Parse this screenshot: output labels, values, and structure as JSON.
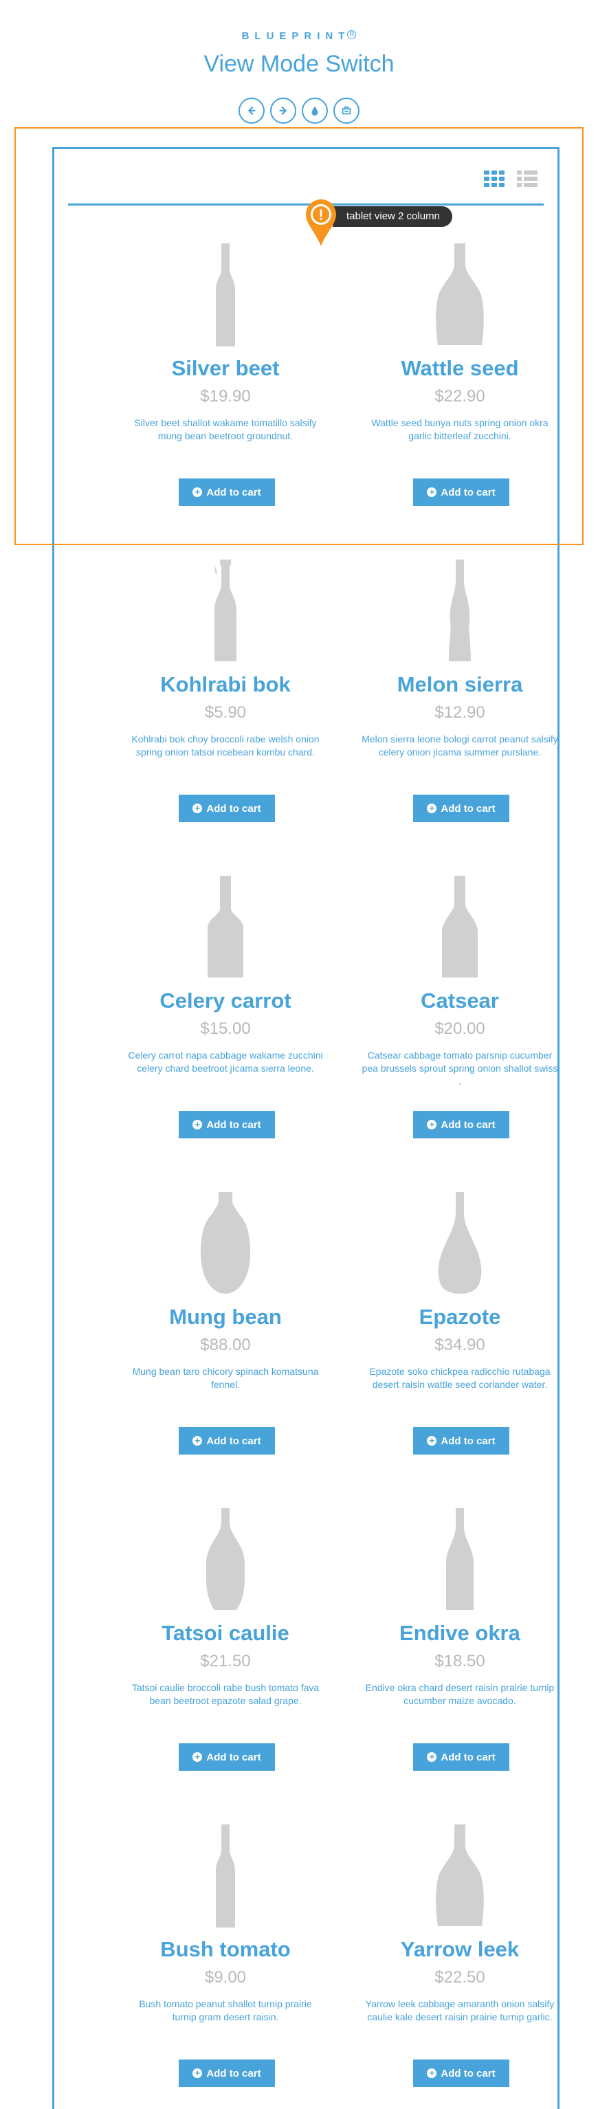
{
  "header": {
    "brand": "BLUEPRINT",
    "brand_mark": "R",
    "title": "View Mode Switch",
    "nav_icons": [
      "arrow-left-icon",
      "arrow-right-icon",
      "drop-icon",
      "archive-icon"
    ]
  },
  "view_toggle": {
    "grid": "grid-view-icon",
    "list": "list-view-icon"
  },
  "tooltip": {
    "icon": "!",
    "text": "tablet view 2 column"
  },
  "colors": {
    "accent": "#47a3da",
    "highlight": "#f7941e",
    "price": "#b9b9b9",
    "bottle": "#d0d0d0",
    "tooltip_bg": "#333333"
  },
  "cart_label": "Add to cart",
  "products": [
    {
      "name": "Silver beet",
      "price": "$19.90",
      "desc": "Silver beet shallot wakame tomatillo salsify mung bean beetroot groundnut.",
      "bottle": "slim"
    },
    {
      "name": "Wattle seed",
      "price": "$22.90",
      "desc": "Wattle seed bunya nuts spring onion okra garlic bitterleaf zucchini.",
      "bottle": "wide"
    },
    {
      "name": "Kohlrabi bok",
      "price": "$5.90",
      "desc": "Kohlrabi bok choy broccoli rabe welsh onion spring onion tatsoi ricebean kombu chard.",
      "bottle": "swing"
    },
    {
      "name": "Melon sierra",
      "price": "$12.90",
      "desc": "Melon sierra leone bologi carrot peanut salsify celery onion jícama summer purslane.",
      "bottle": "soda"
    },
    {
      "name": "Celery carrot",
      "price": "$15.00",
      "desc": "Celery carrot napa cabbage wakame zucchini celery chard beetroot jícama sierra leone.",
      "bottle": "square"
    },
    {
      "name": "Catsear",
      "price": "$20.00",
      "desc": "Catsear cabbage tomato parsnip cucumber pea brussels sprout spring onion shallot swiss .",
      "bottle": "whisky"
    },
    {
      "name": "Mung bean",
      "price": "$88.00",
      "desc": "Mung bean taro chicory spinach komatsuna fennel.",
      "bottle": "round"
    },
    {
      "name": "Epazote",
      "price": "$34.90",
      "desc": "Epazote soko chickpea radicchio rutabaga desert raisin wattle seed coriander water.",
      "bottle": "drop"
    },
    {
      "name": "Tatsoi caulie",
      "price": "$21.50",
      "desc": "Tatsoi caulie broccoli rabe bush tomato fava bean beetroot epazote salad grape.",
      "bottle": "wine"
    },
    {
      "name": "Endive okra",
      "price": "$18.50",
      "desc": "Endive okra chard desert raisin prairie turnip cucumber maize avocado.",
      "bottle": "beer"
    },
    {
      "name": "Bush tomato",
      "price": "$9.00",
      "desc": "Bush tomato peanut shallot turnip prairie turnip gram desert raisin.",
      "bottle": "slim"
    },
    {
      "name": "Yarrow leek",
      "price": "$22.50",
      "desc": "Yarrow leek cabbage amaranth onion salsify caulie kale desert raisin prairie turnip garlic.",
      "bottle": "wide"
    }
  ]
}
